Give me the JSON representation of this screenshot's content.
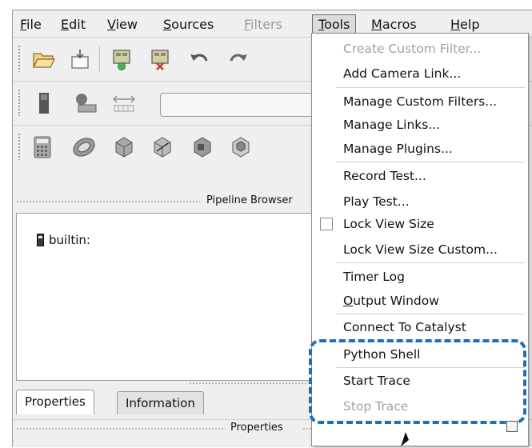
{
  "menubar": [
    {
      "label": "File",
      "ul": "F",
      "rest": "ile",
      "disabled": false,
      "active": false
    },
    {
      "label": "Edit",
      "ul": "E",
      "rest": "dit",
      "disabled": false,
      "active": false
    },
    {
      "label": "View",
      "ul": "V",
      "rest": "iew",
      "disabled": false,
      "active": false
    },
    {
      "label": "Sources",
      "ul": "S",
      "rest": "ources",
      "disabled": false,
      "active": false
    },
    {
      "label": "Filters",
      "ul": "F",
      "rest": "ilters",
      "disabled": true,
      "active": false
    },
    {
      "label": "Tools",
      "ul": "T",
      "rest": "ools",
      "disabled": false,
      "active": true
    },
    {
      "label": "Macros",
      "ul": "M",
      "rest": "acros",
      "disabled": false,
      "active": false
    },
    {
      "label": "Help",
      "ul": "H",
      "rest": "elp",
      "disabled": false,
      "active": false
    }
  ],
  "tools_menu": {
    "items": [
      {
        "label": "Create Custom Filter...",
        "disabled": true
      },
      {
        "label": "Add Camera Link...",
        "disabled": false
      },
      {
        "label": "Manage Custom Filters...",
        "disabled": false
      },
      {
        "label": "Manage Links...",
        "disabled": false
      },
      {
        "label": "Manage Plugins...",
        "disabled": false
      },
      {
        "label": "Record Test...",
        "disabled": false
      },
      {
        "label": "Play Test...",
        "disabled": false
      },
      {
        "label": "Lock View Size",
        "disabled": false,
        "checkbox": true,
        "checked": false
      },
      {
        "label": "Lock View Size Custom...",
        "disabled": false
      },
      {
        "label": "Timer Log",
        "disabled": false
      },
      {
        "label": "Output Window",
        "disabled": false,
        "ul": "O",
        "rest": "utput Window"
      },
      {
        "label": "Connect To Catalyst",
        "disabled": false
      },
      {
        "label": "Python Shell",
        "disabled": false
      },
      {
        "label": "Start Trace",
        "disabled": false
      },
      {
        "label": "Stop Trace",
        "disabled": true
      }
    ]
  },
  "pipeline_browser": {
    "title": "Pipeline Browser",
    "items": [
      {
        "label": "builtin:",
        "icon": "server-icon"
      }
    ]
  },
  "tabs": [
    {
      "label": "Properties",
      "selected": true
    },
    {
      "label": "Information",
      "selected": false
    }
  ],
  "properties_panel": {
    "title": "Properties"
  },
  "colors": {
    "highlight": "#1f6fb7",
    "menu_bg": "#ffffff",
    "chrome": "#efefef"
  }
}
